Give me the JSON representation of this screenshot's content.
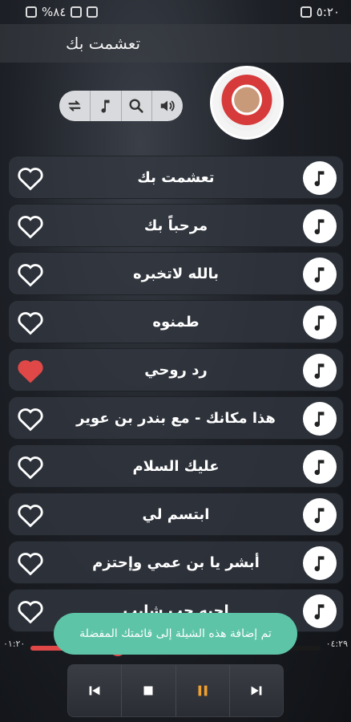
{
  "status_bar": {
    "left_text": "%٨٤",
    "time": "٥:٢٠"
  },
  "header": {
    "title": "تعشمت بك"
  },
  "controls": {
    "icons": [
      "repeat-icon",
      "music-note-icon",
      "search-icon",
      "volume-icon"
    ]
  },
  "songs": [
    {
      "title": "تعشمت بك",
      "favorite": false
    },
    {
      "title": "مرحباً بك",
      "favorite": false
    },
    {
      "title": "بالله لاتخبره",
      "favorite": false
    },
    {
      "title": "طمنوه",
      "favorite": false
    },
    {
      "title": "رد روحي",
      "favorite": true
    },
    {
      "title": "هذا مكانك - مع بندر بن عوير",
      "favorite": false
    },
    {
      "title": "عليك السلام",
      "favorite": false
    },
    {
      "title": "ابتسم لي",
      "favorite": false
    },
    {
      "title": "أبشر يا بن عمي وإحتزم",
      "favorite": false
    },
    {
      "title": "احبه حب شايب",
      "favorite": false
    }
  ],
  "player": {
    "elapsed": "٠١:٢٠",
    "duration": "٠٤:٢٩",
    "progress": 0.3
  },
  "toast": {
    "message": "تم إضافة هذه الشيلة إلى قائمتك المفضلة"
  },
  "colors": {
    "accent_red": "#e04848",
    "toast_green": "#5ec4a7"
  }
}
